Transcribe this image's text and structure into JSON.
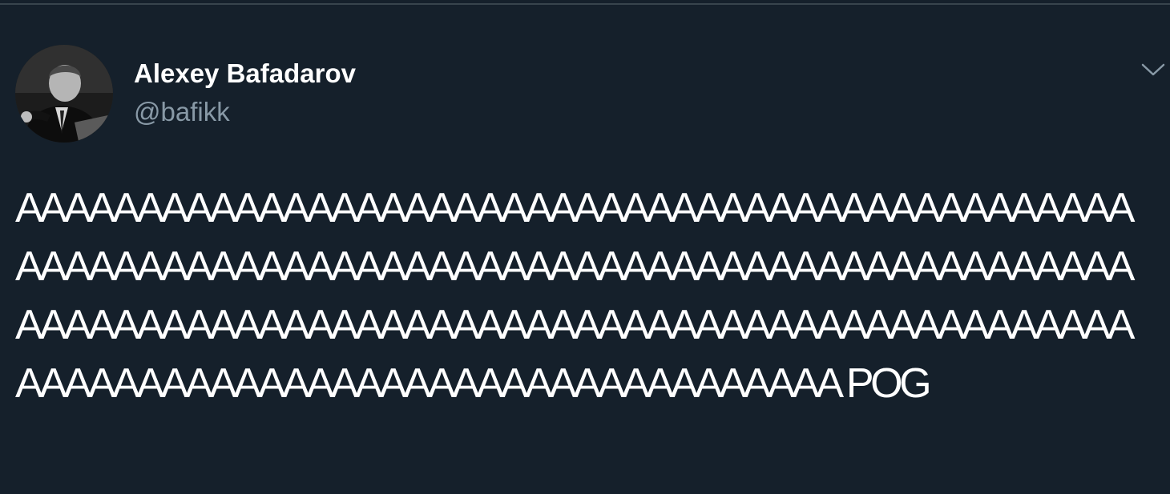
{
  "tweet": {
    "author": {
      "display_name": "Alexey Bafadarov",
      "handle": "@bafikk"
    },
    "text": "AAAAAAAAAAAAAAAAAAAAAAAAAAAAAAAAAAAAAAAAAAAAAAAAAAAAAAAAAAAAAAAAAAAAAAAAAAAAAAAAAAAAAAAAAAAAAAAAAAAAAAAAAAAAAAAAAAAAAAAAAAAAAAAAAAAAAAAAAAAAAAAAAAAAAAAAAAAAAAAAAAAAAAAAAAAA POG",
    "menu_icon": "chevron-down-icon"
  },
  "colors": {
    "background": "#15202b",
    "text_primary": "#ffffff",
    "text_secondary": "#8899a6",
    "border": "#38444d"
  }
}
